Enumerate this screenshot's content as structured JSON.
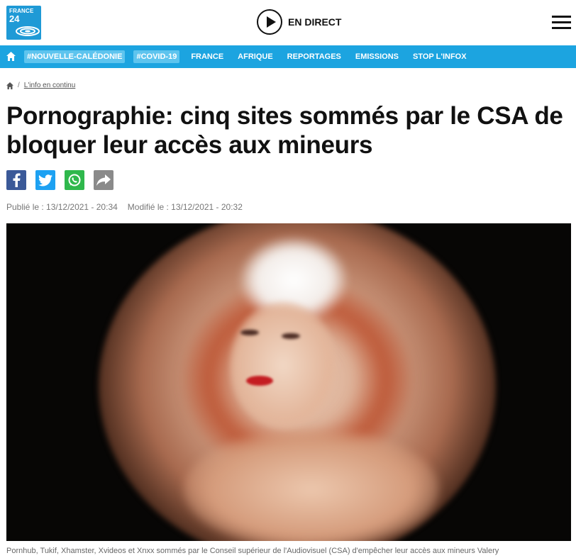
{
  "header": {
    "logo": {
      "line1": "FRANCE",
      "line2": "24"
    },
    "live_label": "EN DIRECT",
    "menu_icon": "hamburger-icon"
  },
  "nav": {
    "home_icon": "home-icon",
    "pills": [
      "#NOUVELLE-CALÉDONIE",
      "#COVID-19"
    ],
    "links": [
      "FRANCE",
      "AFRIQUE",
      "REPORTAGES",
      "EMISSIONS",
      "STOP L'INFOX"
    ],
    "color": "#1ca4e0"
  },
  "breadcrumb": {
    "home_icon": "home-icon",
    "separator": "/",
    "link": "L'info en continu"
  },
  "article": {
    "title": "Pornographie: cinq sites sommés par le CSA de bloquer leur accès aux mineurs",
    "published": "Publié le : 13/12/2021 - 20:34",
    "modified": "Modifié le : 13/12/2021 - 20:32",
    "caption": "Pornhub, Tukif, Xhamster, Xvideos et Xnxx sommés par le Conseil supérieur de l'Audiovisuel (CSA) d'empêcher leur accès aux mineurs  Valery"
  },
  "share": [
    {
      "name": "facebook-icon",
      "color": "#3b5998"
    },
    {
      "name": "twitter-icon",
      "color": "#1da1f2"
    },
    {
      "name": "whatsapp-icon",
      "color": "#2fb84c"
    },
    {
      "name": "share-icon",
      "color": "#8a8a8a"
    }
  ]
}
